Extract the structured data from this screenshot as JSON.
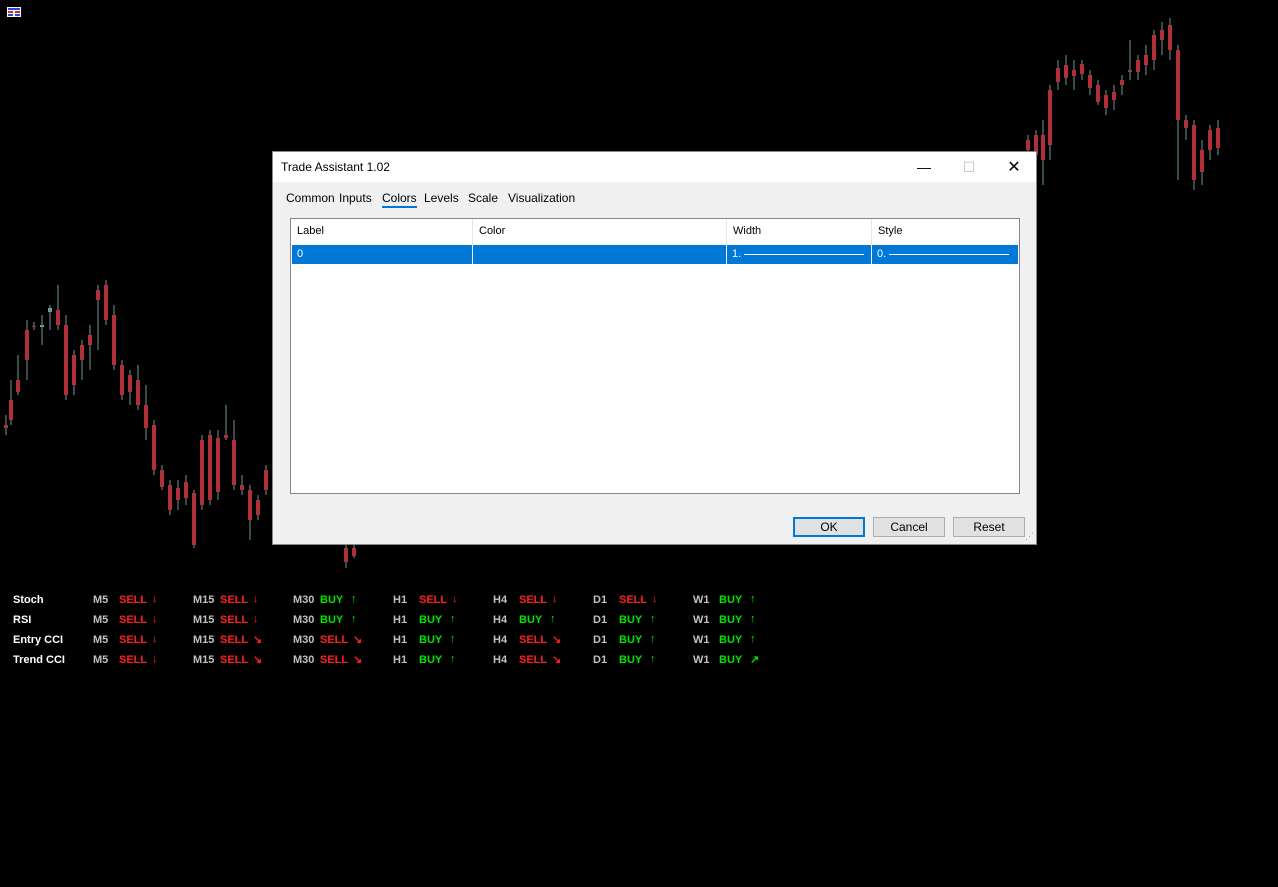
{
  "dialog": {
    "title": "Trade Assistant 1.02",
    "tabs": [
      "Common",
      "Inputs",
      "Colors",
      "Levels",
      "Scale",
      "Visualization"
    ],
    "active_tab": "Colors",
    "columns": [
      "Label",
      "Color",
      "Width",
      "Style"
    ],
    "row": {
      "label": "0",
      "color": "",
      "width": "1.",
      "style": "0."
    },
    "buttons": {
      "ok": "OK",
      "cancel": "Cancel",
      "reset": "Reset"
    },
    "window_icons": {
      "minimize": "minimize-icon",
      "maximize": "maximize-icon",
      "close": "close-icon"
    }
  },
  "signals": {
    "rows": [
      {
        "name": "Stoch",
        "cells": [
          {
            "tf": "M5",
            "signal": "SELL",
            "arrow": "↓"
          },
          {
            "tf": "M15",
            "signal": "SELL",
            "arrow": "↓"
          },
          {
            "tf": "M30",
            "signal": "BUY",
            "arrow": "↑"
          },
          {
            "tf": "H1",
            "signal": "SELL",
            "arrow": "↓"
          },
          {
            "tf": "H4",
            "signal": "SELL",
            "arrow": "↓"
          },
          {
            "tf": "D1",
            "signal": "SELL",
            "arrow": "↓"
          },
          {
            "tf": "W1",
            "signal": "BUY",
            "arrow": "↑"
          }
        ]
      },
      {
        "name": "RSI",
        "cells": [
          {
            "tf": "M5",
            "signal": "SELL",
            "arrow": "↓"
          },
          {
            "tf": "M15",
            "signal": "SELL",
            "arrow": "↓"
          },
          {
            "tf": "M30",
            "signal": "BUY",
            "arrow": "↑"
          },
          {
            "tf": "H1",
            "signal": "BUY",
            "arrow": "↑"
          },
          {
            "tf": "H4",
            "signal": "BUY",
            "arrow": "↑"
          },
          {
            "tf": "D1",
            "signal": "BUY",
            "arrow": "↑"
          },
          {
            "tf": "W1",
            "signal": "BUY",
            "arrow": "↑"
          }
        ]
      },
      {
        "name": "Entry CCI",
        "cells": [
          {
            "tf": "M5",
            "signal": "SELL",
            "arrow": "↓"
          },
          {
            "tf": "M15",
            "signal": "SELL",
            "arrow": "↘"
          },
          {
            "tf": "M30",
            "signal": "SELL",
            "arrow": "↘"
          },
          {
            "tf": "H1",
            "signal": "BUY",
            "arrow": "↑"
          },
          {
            "tf": "H4",
            "signal": "SELL",
            "arrow": "↘"
          },
          {
            "tf": "D1",
            "signal": "BUY",
            "arrow": "↑"
          },
          {
            "tf": "W1",
            "signal": "BUY",
            "arrow": "↑"
          }
        ]
      },
      {
        "name": "Trend CCI",
        "cells": [
          {
            "tf": "M5",
            "signal": "SELL",
            "arrow": "↓"
          },
          {
            "tf": "M15",
            "signal": "SELL",
            "arrow": "↘"
          },
          {
            "tf": "M30",
            "signal": "SELL",
            "arrow": "↘"
          },
          {
            "tf": "H1",
            "signal": "BUY",
            "arrow": "↑"
          },
          {
            "tf": "H4",
            "signal": "SELL",
            "arrow": "↘"
          },
          {
            "tf": "D1",
            "signal": "BUY",
            "arrow": "↑"
          },
          {
            "tf": "W1",
            "signal": "BUY",
            "arrow": "↗"
          }
        ]
      }
    ]
  },
  "colors": {
    "bull": "#6b9a9a",
    "bear": "#b0303a",
    "sell": "#ff2020",
    "buy": "#00e600",
    "accent": "#0078d7"
  }
}
